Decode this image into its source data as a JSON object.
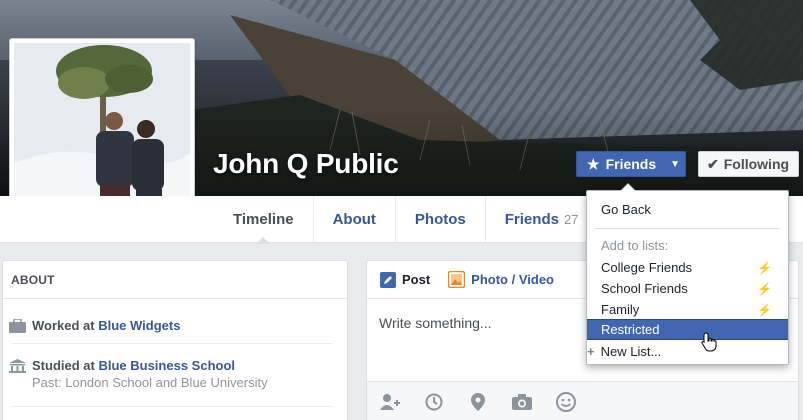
{
  "profile": {
    "name": "John Q Public"
  },
  "header_buttons": {
    "friends_label": "Friends",
    "following_label": "Following"
  },
  "nav": {
    "tabs": [
      {
        "label": "Timeline"
      },
      {
        "label": "About"
      },
      {
        "label": "Photos"
      },
      {
        "label": "Friends",
        "count": "27"
      }
    ]
  },
  "about": {
    "heading": "ABOUT",
    "work": {
      "prefix": "Worked at",
      "org": "Blue Widgets"
    },
    "study": {
      "prefix": "Studied at",
      "org": "Blue Business School",
      "past": "Past: London School and Blue University"
    }
  },
  "composer": {
    "tab_post": "Post",
    "tab_photo": "Photo / Video",
    "placeholder": "Write something..."
  },
  "dropdown": {
    "go_back": "Go Back",
    "section_label": "Add to lists:",
    "lists": [
      "College Friends",
      "School Friends",
      "Family"
    ],
    "restricted": "Restricted",
    "new_list": "New List..."
  },
  "colors": {
    "brand_blue": "#4267b2",
    "link_blue": "#365899"
  }
}
